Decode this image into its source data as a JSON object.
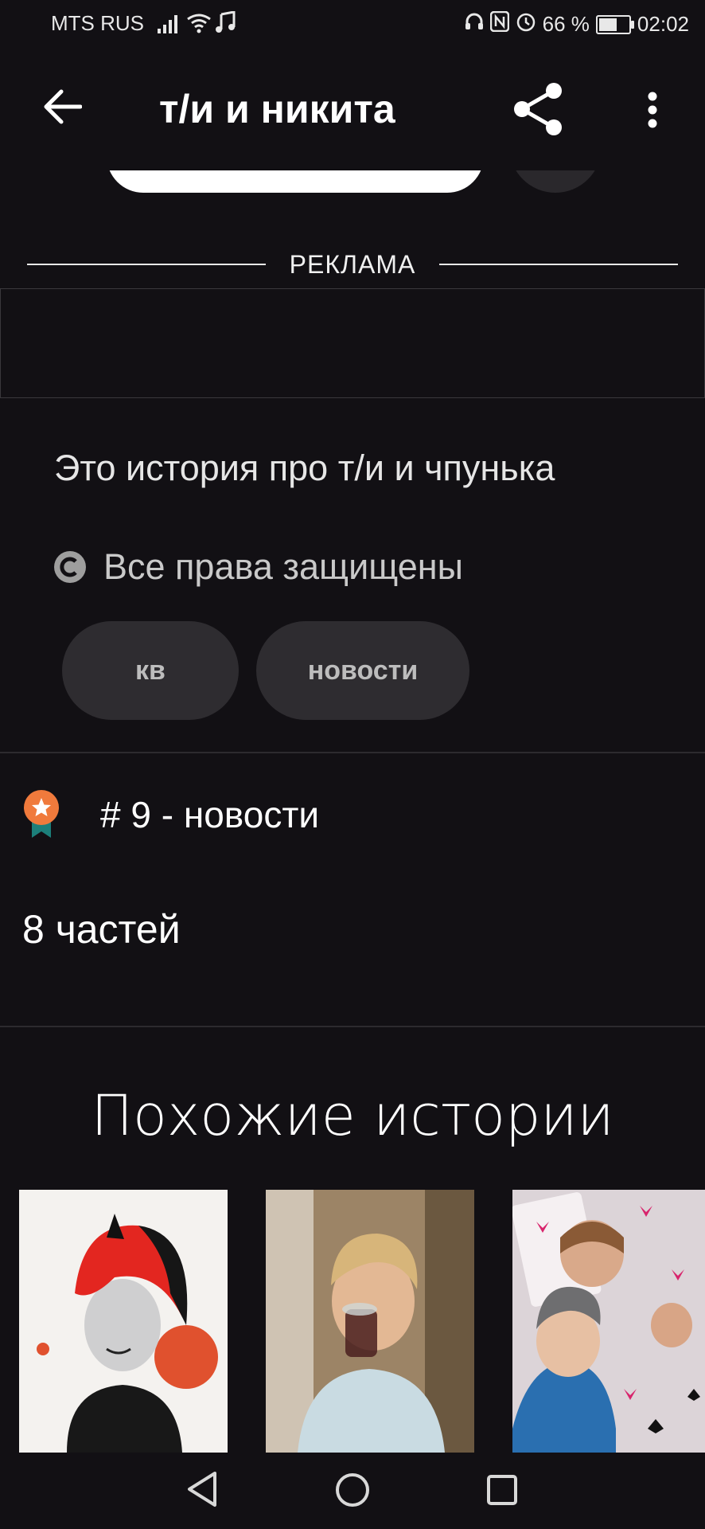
{
  "status_bar": {
    "carrier": "MTS RUS",
    "battery_percent": "66 %",
    "time": "02:02"
  },
  "app_bar": {
    "title": "т/и и никита"
  },
  "ad": {
    "label": "РЕКЛАМА"
  },
  "story": {
    "description": "Это история про т/и и чпунька",
    "copyright": "Все права защищены",
    "tags": [
      "кв",
      "новости"
    ],
    "rank": "# 9 - новости",
    "parts": "8 частей"
  },
  "similar": {
    "heading": "Похожие истории"
  },
  "colors": {
    "background": "#121014",
    "tag_bg": "#2e2c30",
    "badge_orange": "#f07a3c",
    "badge_teal": "#1c7f7a"
  }
}
